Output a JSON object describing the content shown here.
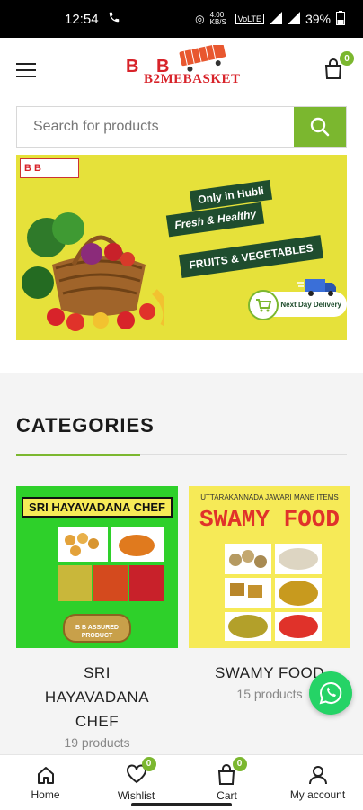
{
  "status_bar": {
    "time": "12:54",
    "net_speed": "4.00 KB/S",
    "battery": "39%"
  },
  "header": {
    "logo_text": "B2MEBASKET",
    "logo_letters": "B B",
    "cart_count": "0"
  },
  "search": {
    "placeholder": "Search for products"
  },
  "banner": {
    "tag": "B B",
    "only_text": "Only in Hubli",
    "fresh_text": "Fresh & Healthy",
    "fruits_text": "FRUITS & VEGETABLES",
    "delivery_text": "Next Day Delivery"
  },
  "categories": {
    "title": "CATEGORIES",
    "items": [
      {
        "image_title": "SRI HAYAVADANA CHEF",
        "image_badge": "B B ASSURED PRODUCT",
        "name": "SRI HAYAVADANA CHEF",
        "count": "19 products",
        "bg": "#2ed02a"
      },
      {
        "image_subtitle": "UTTARAKANNADA JAWARI MANE ITEMS",
        "image_title": "SWAMY FOOD",
        "name": "SWAMY FOOD",
        "count": "15 products",
        "bg": "#f6ea57"
      }
    ]
  },
  "bottom_nav": {
    "home": "Home",
    "wishlist": "Wishlist",
    "wishlist_count": "0",
    "cart": "Cart",
    "cart_count": "0",
    "account": "My account"
  },
  "colors": {
    "accent": "#7bb72f",
    "whatsapp": "#25d366"
  }
}
